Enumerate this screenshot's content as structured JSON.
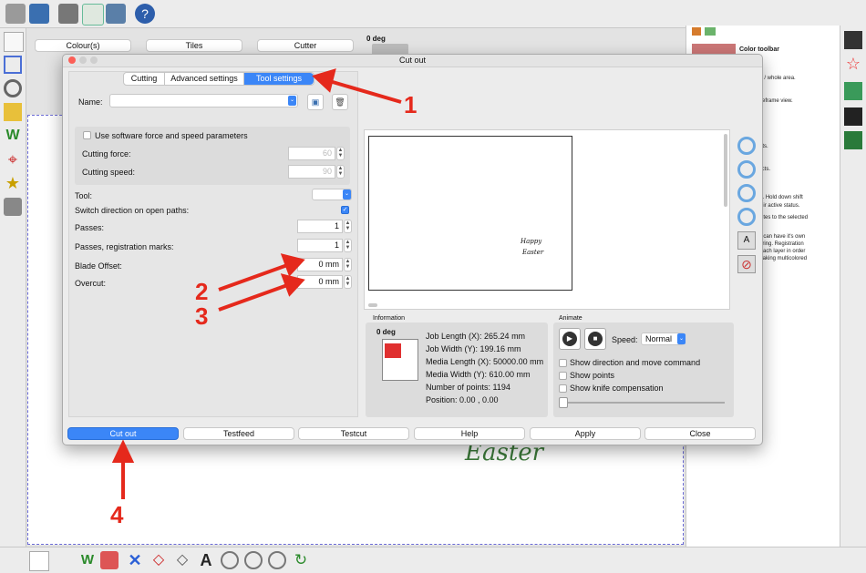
{
  "top_toolbar": {
    "icons": [
      "open-folder-icon",
      "save-disk-icon",
      "print-icon",
      "checklist-icon",
      "tools-icon",
      "help-icon"
    ]
  },
  "tabs_bar": {
    "colours_label": "Colour(s)",
    "tiles_label": "Tiles",
    "cutter_label": "Cutter",
    "deg_label": "0 deg"
  },
  "right_panel": {
    "title": "Color toolbar",
    "lines": [
      "optimized / whole area.",
      "filled / wireframe view.",
      "lled objects.",
      "roke objects.",
      "it's button. Hold down shift",
      "toggle their active status.",
      "set attributes to the selected",
      "layer that can have it's own",
      "and mirroring. Registration",
      "abled in each layer in order",
      "c when making multicolored"
    ]
  },
  "dialog": {
    "title": "Cut out",
    "tabs": [
      {
        "label": "Cutting",
        "active": false
      },
      {
        "label": "Advanced settings",
        "active": false
      },
      {
        "label": "Tool settings",
        "active": true
      }
    ],
    "name_label": "Name:",
    "name_value": "",
    "software_params_label": "Use software force and speed parameters",
    "cutting_force_label": "Cutting force:",
    "cutting_force_value": "60",
    "cutting_speed_label": "Cutting speed:",
    "cutting_speed_value": "90",
    "tool_label": "Tool:",
    "switch_direction_label": "Switch direction on open paths:",
    "passes_label": "Passes:",
    "passes_value": "1",
    "passes_reg_label": "Passes, registration marks:",
    "passes_reg_value": "1",
    "blade_offset_label": "Blade Offset:",
    "blade_offset_value": "0 mm",
    "overcut_label": "Overcut:",
    "overcut_value": "0 mm",
    "preview_text_line1": "Happy",
    "preview_text_line2": "Easter",
    "info": {
      "section_label": "Information",
      "deg_label": "0 deg",
      "job_length": "Job Length (X): 265.24 mm",
      "job_width": "Job Width (Y): 199.16 mm",
      "media_length": "Media Length (X): 50000.00 mm",
      "media_width": "Media Width (Y): 610.00 mm",
      "points": "Number of points: 1194",
      "position": "Position: 0.00 , 0.00"
    },
    "animate": {
      "section_label": "Animate",
      "speed_label": "Speed:",
      "speed_value": "Normal",
      "show_direction": "Show direction and move command",
      "show_points": "Show points",
      "show_knife": "Show knife compensation"
    },
    "buttons": {
      "cut_out": "Cut out",
      "testfeed": "Testfeed",
      "testcut": "Testcut",
      "help": "Help",
      "apply": "Apply",
      "close": "Close"
    }
  },
  "canvas": {
    "bg_text": "Easter"
  },
  "annotations": [
    "1",
    "2",
    "3",
    "4"
  ],
  "colors": {
    "accent_blue": "#3b86f7",
    "annotation_red": "#e5291c",
    "easter_green": "#3c7a3a"
  }
}
